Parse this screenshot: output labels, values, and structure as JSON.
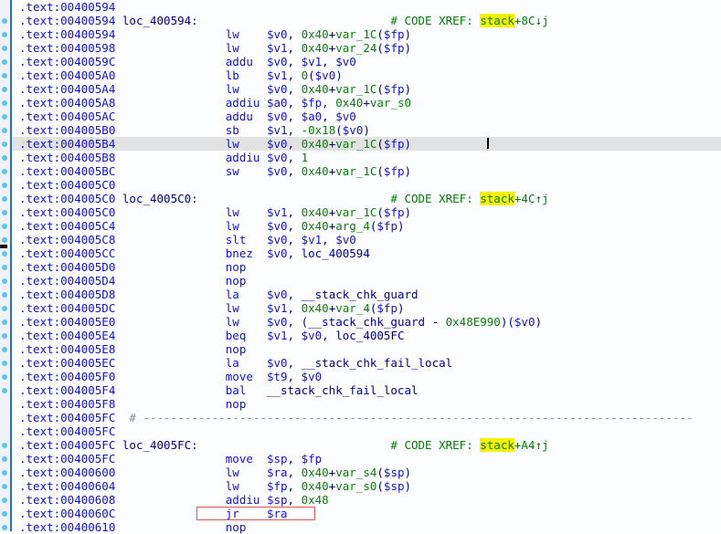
{
  "app": {
    "name": "disassembly-listing",
    "segment": ".text",
    "palette": {
      "background": "#fcfdff",
      "gutter_background": "#eff3f9",
      "gutter_line_blue": "#2473bb",
      "nav_dot_blue": "#60c4f0",
      "address_blue": "#1212d8",
      "name_navy": "#000091",
      "number_green": "#0a7f0a",
      "comment_green": "#008000",
      "xref_highlight_yellow": "#f8f200",
      "current_line_gray": "#e2e2e2",
      "box_red": "#e25353"
    }
  },
  "listing": {
    "lines": [
      {
        "addr": ".text:00400594",
        "dot": false
      },
      {
        "addr": ".text:00400594",
        "label": "loc_400594:",
        "cmt": [
          [
            "c",
            "# CODE XREF: "
          ],
          [
            "h",
            "stack"
          ],
          [
            "c",
            "+8C↓j"
          ]
        ],
        "dot": true
      },
      {
        "addr": ".text:00400594",
        "mn": "lw",
        "ops": [
          [
            "r",
            "$v0"
          ],
          [
            "p",
            ", "
          ],
          [
            "n",
            "0x40"
          ],
          [
            "p",
            "+"
          ],
          [
            "n",
            "var_1C"
          ],
          [
            "p",
            "("
          ],
          [
            "r",
            "$fp"
          ],
          [
            "p",
            ")"
          ]
        ],
        "dot": true
      },
      {
        "addr": ".text:00400598",
        "mn": "lw",
        "ops": [
          [
            "r",
            "$v1"
          ],
          [
            "p",
            ", "
          ],
          [
            "n",
            "0x40"
          ],
          [
            "p",
            "+"
          ],
          [
            "n",
            "var_24"
          ],
          [
            "p",
            "("
          ],
          [
            "r",
            "$fp"
          ],
          [
            "p",
            ")"
          ]
        ],
        "dot": true
      },
      {
        "addr": ".text:0040059C",
        "mn": "addu",
        "ops": [
          [
            "r",
            "$v0"
          ],
          [
            "p",
            ", "
          ],
          [
            "r",
            "$v1"
          ],
          [
            "p",
            ", "
          ],
          [
            "r",
            "$v0"
          ]
        ],
        "dot": true
      },
      {
        "addr": ".text:004005A0",
        "mn": "lb",
        "ops": [
          [
            "r",
            "$v1"
          ],
          [
            "p",
            ", "
          ],
          [
            "n",
            "0"
          ],
          [
            "p",
            "("
          ],
          [
            "r",
            "$v0"
          ],
          [
            "p",
            ")"
          ]
        ],
        "dot": true
      },
      {
        "addr": ".text:004005A4",
        "mn": "lw",
        "ops": [
          [
            "r",
            "$v0"
          ],
          [
            "p",
            ", "
          ],
          [
            "n",
            "0x40"
          ],
          [
            "p",
            "+"
          ],
          [
            "n",
            "var_1C"
          ],
          [
            "p",
            "("
          ],
          [
            "r",
            "$fp"
          ],
          [
            "p",
            ")"
          ]
        ],
        "dot": true
      },
      {
        "addr": ".text:004005A8",
        "mn": "addiu",
        "ops": [
          [
            "r",
            "$a0"
          ],
          [
            "p",
            ", "
          ],
          [
            "r",
            "$fp"
          ],
          [
            "p",
            ", "
          ],
          [
            "n",
            "0x40"
          ],
          [
            "p",
            "+"
          ],
          [
            "n",
            "var_s0"
          ]
        ],
        "dot": true
      },
      {
        "addr": ".text:004005AC",
        "mn": "addu",
        "ops": [
          [
            "r",
            "$v0"
          ],
          [
            "p",
            ", "
          ],
          [
            "r",
            "$a0"
          ],
          [
            "p",
            ", "
          ],
          [
            "r",
            "$v0"
          ]
        ],
        "dot": true
      },
      {
        "addr": ".text:004005B0",
        "mn": "sb",
        "ops": [
          [
            "r",
            "$v1"
          ],
          [
            "p",
            ", "
          ],
          [
            "n",
            "-0x18"
          ],
          [
            "p",
            "("
          ],
          [
            "r",
            "$v0"
          ],
          [
            "p",
            ")"
          ]
        ],
        "dot": true
      },
      {
        "addr": ".text:004005B4",
        "mn": "lw",
        "ops": [
          [
            "r",
            "$v0"
          ],
          [
            "p",
            ", "
          ],
          [
            "n",
            "0x40"
          ],
          [
            "p",
            "+"
          ],
          [
            "n",
            "var_1C"
          ],
          [
            "p",
            "("
          ],
          [
            "r",
            "$fp"
          ],
          [
            "p",
            ")"
          ]
        ],
        "hl": true,
        "caret": true,
        "dot": true
      },
      {
        "addr": ".text:004005B8",
        "mn": "addiu",
        "ops": [
          [
            "r",
            "$v0"
          ],
          [
            "p",
            ", "
          ],
          [
            "n",
            "1"
          ]
        ],
        "dot": true
      },
      {
        "addr": ".text:004005BC",
        "mn": "sw",
        "ops": [
          [
            "r",
            "$v0"
          ],
          [
            "p",
            ", "
          ],
          [
            "n",
            "0x40"
          ],
          [
            "p",
            "+"
          ],
          [
            "n",
            "var_1C"
          ],
          [
            "p",
            "("
          ],
          [
            "r",
            "$fp"
          ],
          [
            "p",
            ")"
          ]
        ],
        "dot": true
      },
      {
        "addr": ".text:004005C0",
        "dot": true
      },
      {
        "addr": ".text:004005C0",
        "label": "loc_4005C0:",
        "cmt": [
          [
            "c",
            "# CODE XREF: "
          ],
          [
            "h",
            "stack"
          ],
          [
            "c",
            "+4C↑j"
          ]
        ],
        "dot": true
      },
      {
        "addr": ".text:004005C0",
        "mn": "lw",
        "ops": [
          [
            "r",
            "$v1"
          ],
          [
            "p",
            ", "
          ],
          [
            "n",
            "0x40"
          ],
          [
            "p",
            "+"
          ],
          [
            "n",
            "var_1C"
          ],
          [
            "p",
            "("
          ],
          [
            "r",
            "$fp"
          ],
          [
            "p",
            ")"
          ]
        ],
        "dot": true
      },
      {
        "addr": ".text:004005C4",
        "mn": "lw",
        "ops": [
          [
            "r",
            "$v0"
          ],
          [
            "p",
            ", "
          ],
          [
            "n",
            "0x40"
          ],
          [
            "p",
            "+"
          ],
          [
            "n",
            "arg_4"
          ],
          [
            "p",
            "("
          ],
          [
            "r",
            "$fp"
          ],
          [
            "p",
            ")"
          ]
        ],
        "dot": true
      },
      {
        "addr": ".text:004005C8",
        "mn": "slt",
        "ops": [
          [
            "r",
            "$v0"
          ],
          [
            "p",
            ", "
          ],
          [
            "r",
            "$v1"
          ],
          [
            "p",
            ", "
          ],
          [
            "r",
            "$v0"
          ]
        ],
        "dot": true
      },
      {
        "addr": ".text:004005CC",
        "mn": "bnez",
        "ops": [
          [
            "r",
            "$v0"
          ],
          [
            "p",
            ", "
          ],
          [
            "m",
            "loc_400594"
          ]
        ],
        "dot": true,
        "dash": true
      },
      {
        "addr": ".text:004005D0",
        "mn": "nop",
        "dot": true
      },
      {
        "addr": ".text:004005D4",
        "mn": "nop",
        "dot": true
      },
      {
        "addr": ".text:004005D8",
        "mn": "la",
        "ops": [
          [
            "r",
            "$v0"
          ],
          [
            "p",
            ", "
          ],
          [
            "m",
            "__stack_chk_guard"
          ]
        ],
        "dot": true
      },
      {
        "addr": ".text:004005DC",
        "mn": "lw",
        "ops": [
          [
            "r",
            "$v1"
          ],
          [
            "p",
            ", "
          ],
          [
            "n",
            "0x40"
          ],
          [
            "p",
            "+"
          ],
          [
            "n",
            "var_4"
          ],
          [
            "p",
            "("
          ],
          [
            "r",
            "$fp"
          ],
          [
            "p",
            ")"
          ]
        ],
        "dot": true
      },
      {
        "addr": ".text:004005E0",
        "mn": "lw",
        "ops": [
          [
            "r",
            "$v0"
          ],
          [
            "p",
            ", ("
          ],
          [
            "m",
            "__stack_chk_guard"
          ],
          [
            "p",
            " - "
          ],
          [
            "n",
            "0x48E990"
          ],
          [
            "p",
            ")("
          ],
          [
            "r",
            "$v0"
          ],
          [
            "p",
            ")"
          ]
        ],
        "dot": true
      },
      {
        "addr": ".text:004005E4",
        "mn": "beq",
        "ops": [
          [
            "r",
            "$v1"
          ],
          [
            "p",
            ", "
          ],
          [
            "r",
            "$v0"
          ],
          [
            "p",
            ", "
          ],
          [
            "m",
            "loc_4005FC"
          ]
        ],
        "dot": true
      },
      {
        "addr": ".text:004005E8",
        "mn": "nop",
        "dot": true
      },
      {
        "addr": ".text:004005EC",
        "mn": "la",
        "ops": [
          [
            "r",
            "$v0"
          ],
          [
            "p",
            ", "
          ],
          [
            "m",
            "__stack_chk_fail_local"
          ]
        ],
        "dot": true
      },
      {
        "addr": ".text:004005F0",
        "mn": "move",
        "ops": [
          [
            "r",
            "$t9"
          ],
          [
            "p",
            ", "
          ],
          [
            "r",
            "$v0"
          ]
        ],
        "dot": true
      },
      {
        "addr": ".text:004005F4",
        "mn": "bal",
        "ops": [
          [
            "m",
            "__stack_chk_fail_local"
          ]
        ],
        "dot": true
      },
      {
        "addr": ".text:004005F8",
        "mn": "nop",
        "dot": false
      },
      {
        "addr": ".text:004005FC",
        "sep": "# --------------------------------------------------------------------------------",
        "dot": false
      },
      {
        "addr": ".text:004005FC",
        "dot": false
      },
      {
        "addr": ".text:004005FC",
        "label": "loc_4005FC:",
        "cmt": [
          [
            "c",
            "# CODE XREF: "
          ],
          [
            "h",
            "stack"
          ],
          [
            "c",
            "+A4↑j"
          ]
        ],
        "dot": true
      },
      {
        "addr": ".text:004005FC",
        "mn": "move",
        "ops": [
          [
            "r",
            "$sp"
          ],
          [
            "p",
            ", "
          ],
          [
            "r",
            "$fp"
          ]
        ],
        "dot": true
      },
      {
        "addr": ".text:00400600",
        "mn": "lw",
        "ops": [
          [
            "r",
            "$ra"
          ],
          [
            "p",
            ", "
          ],
          [
            "n",
            "0x40"
          ],
          [
            "p",
            "+"
          ],
          [
            "n",
            "var_s4"
          ],
          [
            "p",
            "("
          ],
          [
            "r",
            "$sp"
          ],
          [
            "p",
            ")"
          ]
        ],
        "dot": true
      },
      {
        "addr": ".text:00400604",
        "mn": "lw",
        "ops": [
          [
            "r",
            "$fp"
          ],
          [
            "p",
            ", "
          ],
          [
            "n",
            "0x40"
          ],
          [
            "p",
            "+"
          ],
          [
            "n",
            "var_s0"
          ],
          [
            "p",
            "("
          ],
          [
            "r",
            "$sp"
          ],
          [
            "p",
            ")"
          ]
        ],
        "dot": true
      },
      {
        "addr": ".text:00400608",
        "mn": "addiu",
        "ops": [
          [
            "r",
            "$sp"
          ],
          [
            "p",
            ", "
          ],
          [
            "n",
            "0x48"
          ]
        ],
        "dot": true
      },
      {
        "addr": ".text:0040060C",
        "mn": "jr",
        "ops": [
          [
            "r",
            "$ra"
          ]
        ],
        "box": true,
        "dot": true
      },
      {
        "addr": ".text:00400610",
        "mn": "nop",
        "dot": true
      }
    ]
  }
}
